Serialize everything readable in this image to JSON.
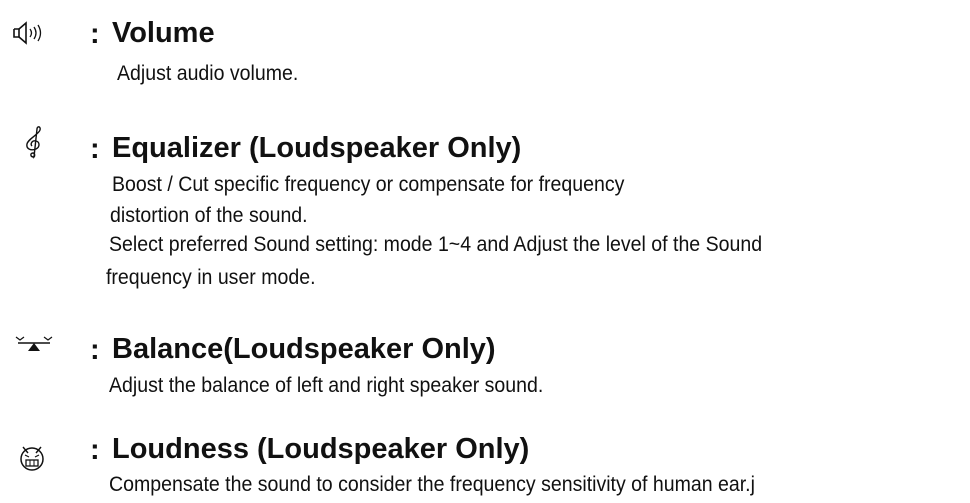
{
  "sections": [
    {
      "icon": "speaker-volume-icon",
      "colon": ":",
      "title": "Volume",
      "lines": [
        "Adjust audio volume."
      ]
    },
    {
      "icon": "treble-clef-icon",
      "colon": ":",
      "title": "Equalizer (Loudspeaker Only)",
      "lines": [
        "Boost / Cut specific frequency or compensate for frequency",
        "distortion of the sound.",
        "Select preferred Sound setting: mode 1~4 and Adjust the level of the Sound",
        "frequency in user mode."
      ]
    },
    {
      "icon": "balance-icon",
      "colon": ":",
      "title": "Balance(Loudspeaker Only)",
      "lines": [
        "Adjust the balance of left and right speaker sound."
      ]
    },
    {
      "icon": "loudness-face-icon",
      "colon": ":",
      "title": "Loudness (Loudspeaker Only)",
      "lines": [
        "Compensate the sound to consider the frequency sensitivity of human ear.j"
      ]
    }
  ]
}
